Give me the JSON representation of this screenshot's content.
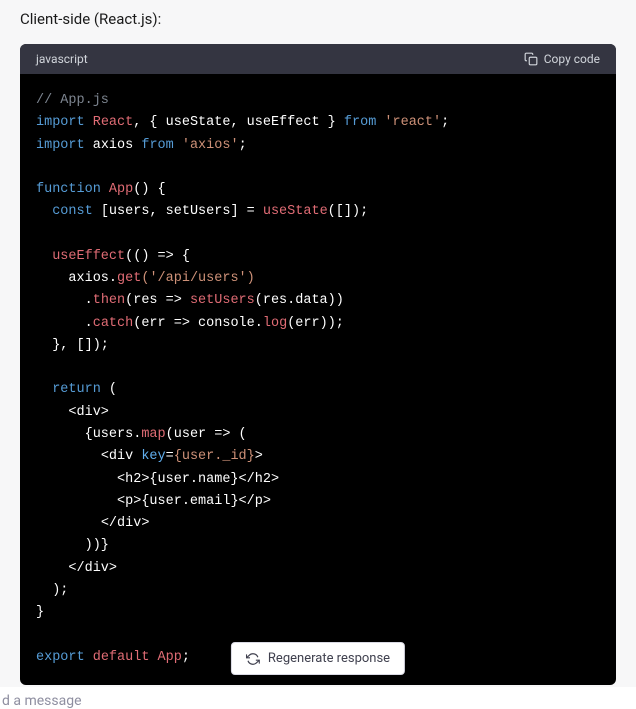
{
  "section_title": "Client-side (React.js):",
  "code_block": {
    "language": "javascript",
    "copy_label": "Copy code",
    "tokens": {
      "comment_appjs": "// App.js",
      "import": "import",
      "react_default": "React",
      "brace_open_import": ", { ",
      "usestate": "useState",
      "comma_sep": ", ",
      "useeffect": "useEffect",
      "brace_close_import": " } ",
      "from": "from",
      "react_str": "'react'",
      "semicolon": ";",
      "axios": "axios",
      "axios_str": "'axios'",
      "function": "function",
      "app_fn": "App",
      "paren_empty": "()",
      "brace_open": " {",
      "const": "const",
      "destructure_open": " [",
      "users_var": "users",
      "setusers_var": "setUsers",
      "destructure_close": "] = ",
      "usestate_call": "useState",
      "empty_arr": "([]);",
      "useeffect_call": "useEffect",
      "arrow_open": "(() => {",
      "axios_obj": "axios",
      "dot": ".",
      "get_method": "get",
      "api_users_str": "('/api/users')",
      "then_method": "then",
      "res_param": "(res => ",
      "setusers_call": "setUsers",
      "res_data": "(res.data))",
      "catch_method": "catch",
      "err_param": "(err => ",
      "console_obj": "console",
      "log_method": "log",
      "err_arg": "(err));",
      "useeffect_close": "}, []);",
      "return": "return",
      "return_paren": " (",
      "div_open": "<div>",
      "users_map_open": "{users.",
      "map_method": "map",
      "user_param": "(user => (",
      "div_key_open": "<div ",
      "key_attr": "key",
      "key_eq": "=",
      "user_id_expr": "{user._id}",
      "tag_close_gt": ">",
      "h2_open": "<h2>",
      "user_name_expr": "{user.name}",
      "h2_close": "</h2>",
      "p_open": "<p>",
      "user_email_expr": "{user.email}",
      "p_close": "</p>",
      "div_close": "</div>",
      "map_close": "))}",
      "return_close": ");",
      "fn_close": "}",
      "export": "export",
      "default": "default",
      "app_export": "App"
    }
  },
  "regenerate_label": "Regenerate response",
  "footer_placeholder_partial": "d a message"
}
